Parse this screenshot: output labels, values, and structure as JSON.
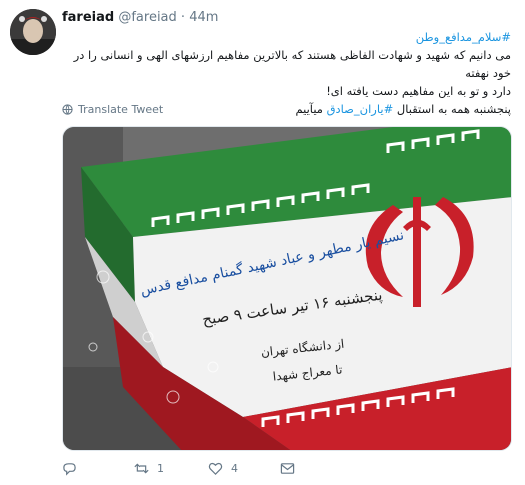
{
  "tweet": {
    "display_name": "fareiad",
    "handle": "@fareiad",
    "separator": "·",
    "time": "44m",
    "hashtag_line": "#سلام_مدافع_وطن",
    "line1": "می دانیم که شهید و شهادت الفاظی هستند که بالاترین مفاهیم ارزشهای الهی و انسانی را در خود نهفته",
    "line2": "دارد و تو به این مفاهیم دست یافته ای!",
    "line3_text": "پنجشنبه همه به استقبال ",
    "line3_hashtag": "#یاران_صادق",
    "line3_end": " میآییم",
    "translate_label": "Translate Tweet"
  },
  "media": {
    "line1": "نسیم یار مطهر و عباد شهید گمنام مدافع قدس",
    "line2": "پنجشنبه ۱۶ تیر ساعت ۹ صبح",
    "line3": "از دانشگاه تهران",
    "line4": "تا معراج شهدا",
    "colors": {
      "green": "#2e8b3c",
      "white": "#f4f4f4",
      "red": "#c8202a"
    }
  },
  "actions": {
    "reply_icon": "reply-icon",
    "retweet_count": "1",
    "like_count": "4",
    "dm_icon": "message-icon"
  }
}
